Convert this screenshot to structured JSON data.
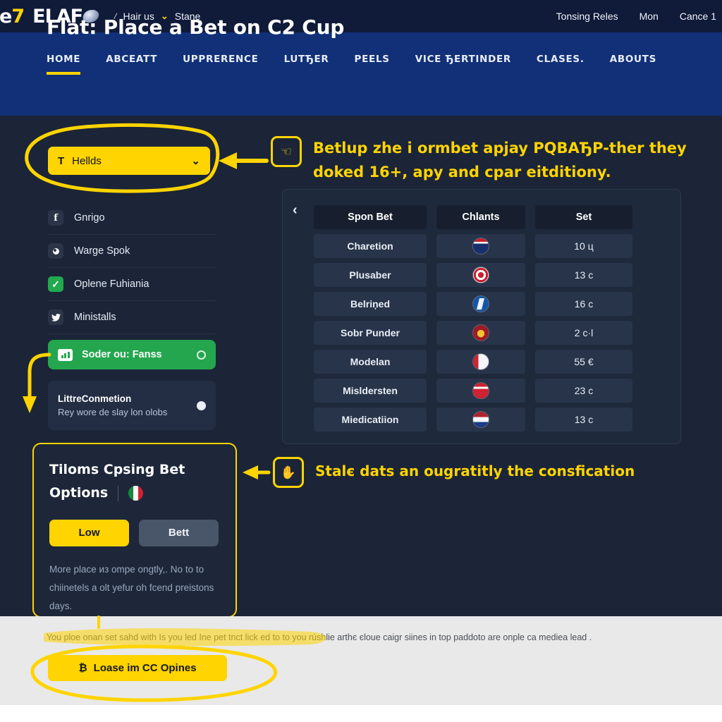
{
  "topbar": {
    "logo_primary": "ce",
    "logo_primary_accent": "7",
    "logo_secondary": "ELAF",
    "breadcrumb_slash": "/",
    "breadcrumb_item": "Hair us",
    "breadcrumb_chevron": "⌄",
    "breadcrumb_last": "Stane",
    "links": [
      "Tonsing Reles",
      "Mon",
      "Cance 1"
    ]
  },
  "hero": {
    "title": "Flat: Place a Bet on C2 Cup",
    "tabs": [
      {
        "label": "HOME",
        "active": true
      },
      {
        "label": "ABCEATT",
        "active": false
      },
      {
        "label": "UPPRERENCE",
        "active": false
      },
      {
        "label": "LUTЂER",
        "active": false
      },
      {
        "label": "PEELS",
        "active": false
      },
      {
        "label": "VICE ЂERTINDER",
        "active": false
      },
      {
        "label": "CLASES.",
        "active": false
      },
      {
        "label": "ABOUTS",
        "active": false
      }
    ]
  },
  "dropdown": {
    "prefix": "T",
    "value": "Hellds",
    "chevron": "⌄"
  },
  "sidebar": {
    "items": [
      {
        "label": "Gnrigo",
        "icon": "facebook-icon",
        "glyph": "f"
      },
      {
        "label": "Warge Spok",
        "icon": "camera-icon",
        "glyph": ""
      },
      {
        "label": "Oplene Fuhiania",
        "icon": "check-icon",
        "glyph": "✓"
      },
      {
        "label": "Ministalls",
        "icon": "twitter-icon",
        "glyph": "🐦"
      }
    ],
    "green_button": {
      "label": "Soder ou: Fanss",
      "icon": "chart-icon"
    },
    "card": {
      "title": "LittreConmetion",
      "subtitle": "Rey wore de slay lon olobs"
    }
  },
  "panel": {
    "back_icon": "‹",
    "columns": [
      "Spon Bet",
      "Chlants",
      "Set"
    ],
    "rows": [
      {
        "name": "Charetion",
        "flag": "fl-a",
        "value": "10 ц"
      },
      {
        "name": "Plusaber",
        "flag": "fl-b",
        "value": "13 c"
      },
      {
        "name": "Belriņed",
        "flag": "fl-c",
        "value": "16 c"
      },
      {
        "name": "Sobr Punder",
        "flag": "fl-d",
        "value": "2 c·l"
      },
      {
        "name": "Modelan",
        "flag": "fl-e",
        "value": "55 €"
      },
      {
        "name": "Misldersten",
        "flag": "fl-f",
        "value": "23 c"
      },
      {
        "name": "Miedicatiion",
        "flag": "fl-g",
        "value": "13 c"
      }
    ]
  },
  "bet_card": {
    "title_line1": "Tiloms Cpsing Bet",
    "title_line2": "Options",
    "flag": "italy-flag",
    "button_primary": "Low",
    "button_secondary": "Bett",
    "note": "More place из ompe ongtly,. No to to chiinetels a olt yefur oh fcend preistons days."
  },
  "annotations": [
    {
      "badge_icon": "cursor-click-icon",
      "badge_glyph": "☜",
      "text": "Betlup zhe i ormbet apjay PQBAЂP-ther they doked 16+, apy and cpar eitditiony."
    },
    {
      "badge_icon": "hand-pointer-icon",
      "badge_glyph": "✋",
      "text": "Stalє dats an ougratitly the consfication"
    }
  ],
  "bottom": {
    "note": "You ploe onan set ѕаhd with Is you led Ine pet tnct lick ed to to you rúshlie arthє єloue caigr siines in top paddoto are onple ca mediea lead .",
    "button_icon": "₿",
    "button_label": "Loase im CC Opines"
  },
  "colors": {
    "accent_yellow": "#ffd400",
    "hero_blue": "#113077",
    "topbar_navy": "#101a39",
    "body_navy": "#1b2537",
    "green": "#24a64e"
  }
}
